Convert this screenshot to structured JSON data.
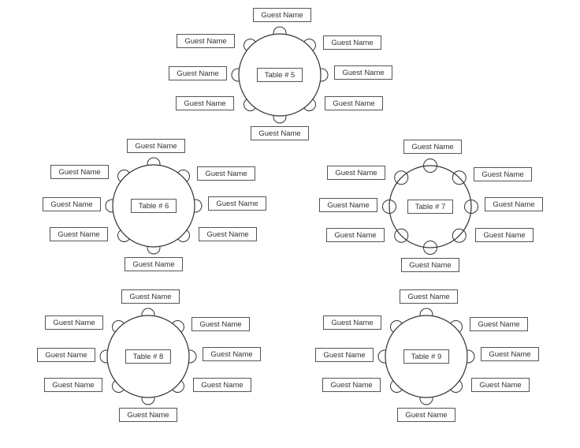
{
  "tables": [
    {
      "label": "Table # 5",
      "chairs": "half",
      "guests": [
        "Guest Name",
        "Guest Name",
        "Guest Name",
        "Guest Name",
        "Guest Name",
        "Guest Name",
        "Guest Name",
        "Guest Name"
      ]
    },
    {
      "label": "Table # 6",
      "chairs": "half",
      "guests": [
        "Guest Name",
        "Guest Name",
        "Guest Name",
        "Guest Name",
        "Guest Name",
        "Guest Name",
        "Guest Name",
        "Guest Name"
      ]
    },
    {
      "label": "Table # 7",
      "chairs": "full",
      "guests": [
        "Guest Name",
        "Guest Name",
        "Guest Name",
        "Guest Name",
        "Guest Name",
        "Guest Name",
        "Guest Name",
        "Guest Name"
      ]
    },
    {
      "label": "Table # 8",
      "chairs": "half",
      "guests": [
        "Guest Name",
        "Guest Name",
        "Guest Name",
        "Guest Name",
        "Guest Name",
        "Guest Name",
        "Guest Name",
        "Guest Name"
      ]
    },
    {
      "label": "Table # 9",
      "chairs": "half",
      "guests": [
        "Guest Name",
        "Guest Name",
        "Guest Name",
        "Guest Name",
        "Guest Name",
        "Guest Name",
        "Guest Name",
        "Guest Name"
      ]
    }
  ]
}
